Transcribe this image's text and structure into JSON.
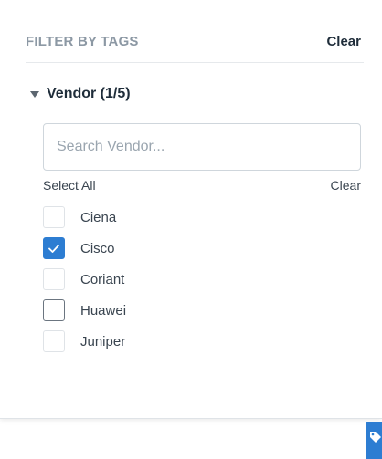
{
  "filter_panel": {
    "title": "FILTER BY TAGS",
    "clear_label": "Clear"
  },
  "vendor_group": {
    "title": "Vendor (1/5)",
    "search_placeholder": "Search Vendor...",
    "search_value": "",
    "select_all_label": "Select All",
    "clear_label": "Clear",
    "options": [
      {
        "label": "Ciena",
        "checked": false
      },
      {
        "label": "Cisco",
        "checked": true
      },
      {
        "label": "Coriant",
        "checked": false
      },
      {
        "label": "Huawei",
        "checked": false
      },
      {
        "label": "Juniper",
        "checked": false
      }
    ]
  },
  "colors": {
    "accent": "#2d7dd2",
    "muted_header": "#8c98a4"
  },
  "icons": {
    "group_toggle": "caret-down-icon",
    "checked": "checkmark-icon",
    "side_tab": "tag-icon"
  }
}
